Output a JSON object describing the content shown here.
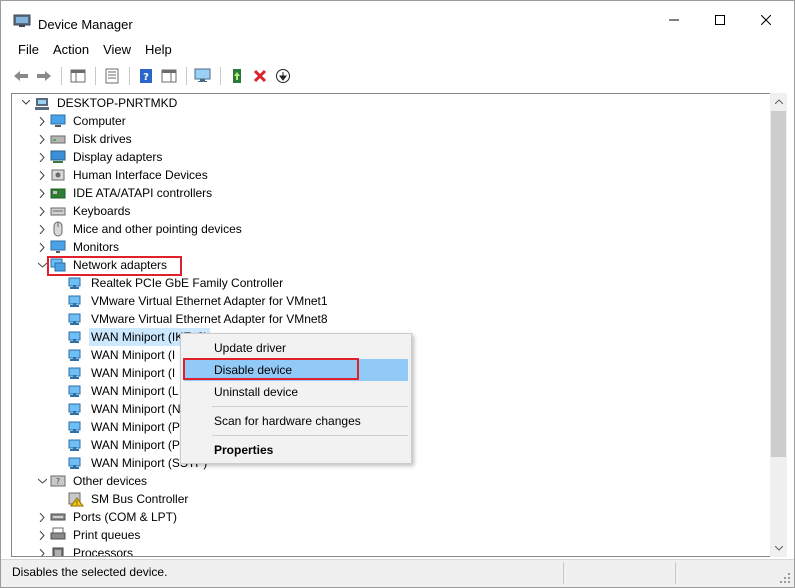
{
  "window": {
    "title": "Device Manager"
  },
  "menu": [
    "File",
    "Action",
    "View",
    "Help"
  ],
  "tree": {
    "root": "DESKTOP-PNRTMKD",
    "categories_top": [
      {
        "label": "Computer",
        "icon": "computer-icon"
      },
      {
        "label": "Disk drives",
        "icon": "disk-drive-icon"
      },
      {
        "label": "Display adapters",
        "icon": "display-adapter-icon"
      },
      {
        "label": "Human Interface Devices",
        "icon": "hid-icon"
      },
      {
        "label": "IDE ATA/ATAPI controllers",
        "icon": "ide-controller-icon"
      },
      {
        "label": "Keyboards",
        "icon": "keyboard-icon"
      },
      {
        "label": "Mice and other pointing devices",
        "icon": "mouse-icon"
      },
      {
        "label": "Monitors",
        "icon": "monitor-icon"
      }
    ],
    "network": {
      "label": "Network adapters",
      "children": [
        "Realtek PCIe GbE Family Controller",
        "VMware Virtual Ethernet Adapter for VMnet1",
        "VMware Virtual Ethernet Adapter for VMnet8",
        "WAN Miniport (IKEv2)",
        "WAN Miniport (IP)",
        "WAN Miniport (IPv6)",
        "WAN Miniport (L2TP)",
        "WAN Miniport (Network Monitor)",
        "WAN Miniport (PPPOE)",
        "WAN Miniport (PPTP)",
        "WAN Miniport (SSTP)"
      ],
      "children_visible": [
        "Realtek PCIe GbE Family Controller",
        "VMware Virtual Ethernet Adapter for VMnet1",
        "VMware Virtual Ethernet Adapter for VMnet8",
        "WAN Miniport (IKEv2)",
        "WAN Miniport (I",
        "WAN Miniport (I",
        "WAN Miniport (L",
        "WAN Miniport (N",
        "WAN Miniport (P",
        "WAN Miniport (P",
        "WAN Miniport (SSTP)"
      ]
    },
    "other": {
      "label": "Other devices",
      "children": [
        "SM Bus Controller"
      ]
    },
    "categories_bottom": [
      {
        "label": "Ports (COM & LPT)",
        "icon": "port-icon"
      },
      {
        "label": "Print queues",
        "icon": "printer-icon"
      },
      {
        "label": "Processors",
        "icon": "processor-icon"
      }
    ]
  },
  "context_menu": {
    "update_driver": "Update driver",
    "disable_device": "Disable device",
    "uninstall_device": "Uninstall device",
    "scan_hardware": "Scan for hardware changes",
    "properties": "Properties"
  },
  "status": {
    "text": "Disables the selected device."
  },
  "colors": {
    "selection": "#cce8ff",
    "menu_hover": "#91c9f7",
    "highlight_red": "#e0202a"
  }
}
